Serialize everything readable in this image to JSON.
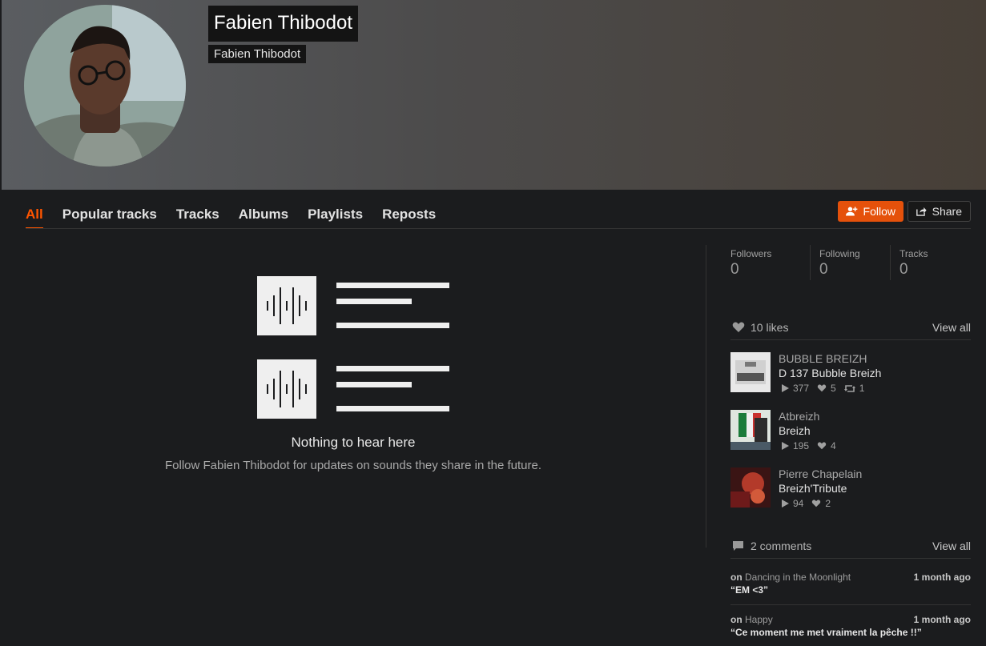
{
  "profile": {
    "display_name": "Fabien Thibodot",
    "username": "Fabien Thibodot"
  },
  "tabs": [
    {
      "label": "All",
      "active": true
    },
    {
      "label": "Popular tracks"
    },
    {
      "label": "Tracks"
    },
    {
      "label": "Albums"
    },
    {
      "label": "Playlists"
    },
    {
      "label": "Reposts"
    }
  ],
  "actions": {
    "follow_label": "Follow",
    "share_label": "Share",
    "follow_color": "#e5510b"
  },
  "empty_state": {
    "title": "Nothing to hear here",
    "subtitle": "Follow Fabien Thibodot for updates on sounds they share in the future."
  },
  "stats": [
    {
      "label": "Followers",
      "value": "0"
    },
    {
      "label": "Following",
      "value": "0"
    },
    {
      "label": "Tracks",
      "value": "0"
    }
  ],
  "likes": {
    "header": "10 likes",
    "view_all": "View all",
    "items": [
      {
        "artist": "BUBBLE BREIZH",
        "title": "D 137 Bubble Breizh",
        "plays": "377",
        "likes": "5",
        "reposts": "1"
      },
      {
        "artist": "Atbreizh",
        "title": "Breizh",
        "plays": "195",
        "likes": "4"
      },
      {
        "artist": "Pierre Chapelain",
        "title": "Breizh'Tribute",
        "plays": "94",
        "likes": "2"
      }
    ]
  },
  "comments": {
    "header": "2 comments",
    "view_all": "View all",
    "on_label": "on",
    "items": [
      {
        "track": "Dancing in the Moonlight",
        "when": "1 month ago",
        "text": "“EM <3”"
      },
      {
        "track": "Happy",
        "when": "1 month ago",
        "text": "“Ce moment me met vraiment la pêche !!”"
      }
    ]
  }
}
